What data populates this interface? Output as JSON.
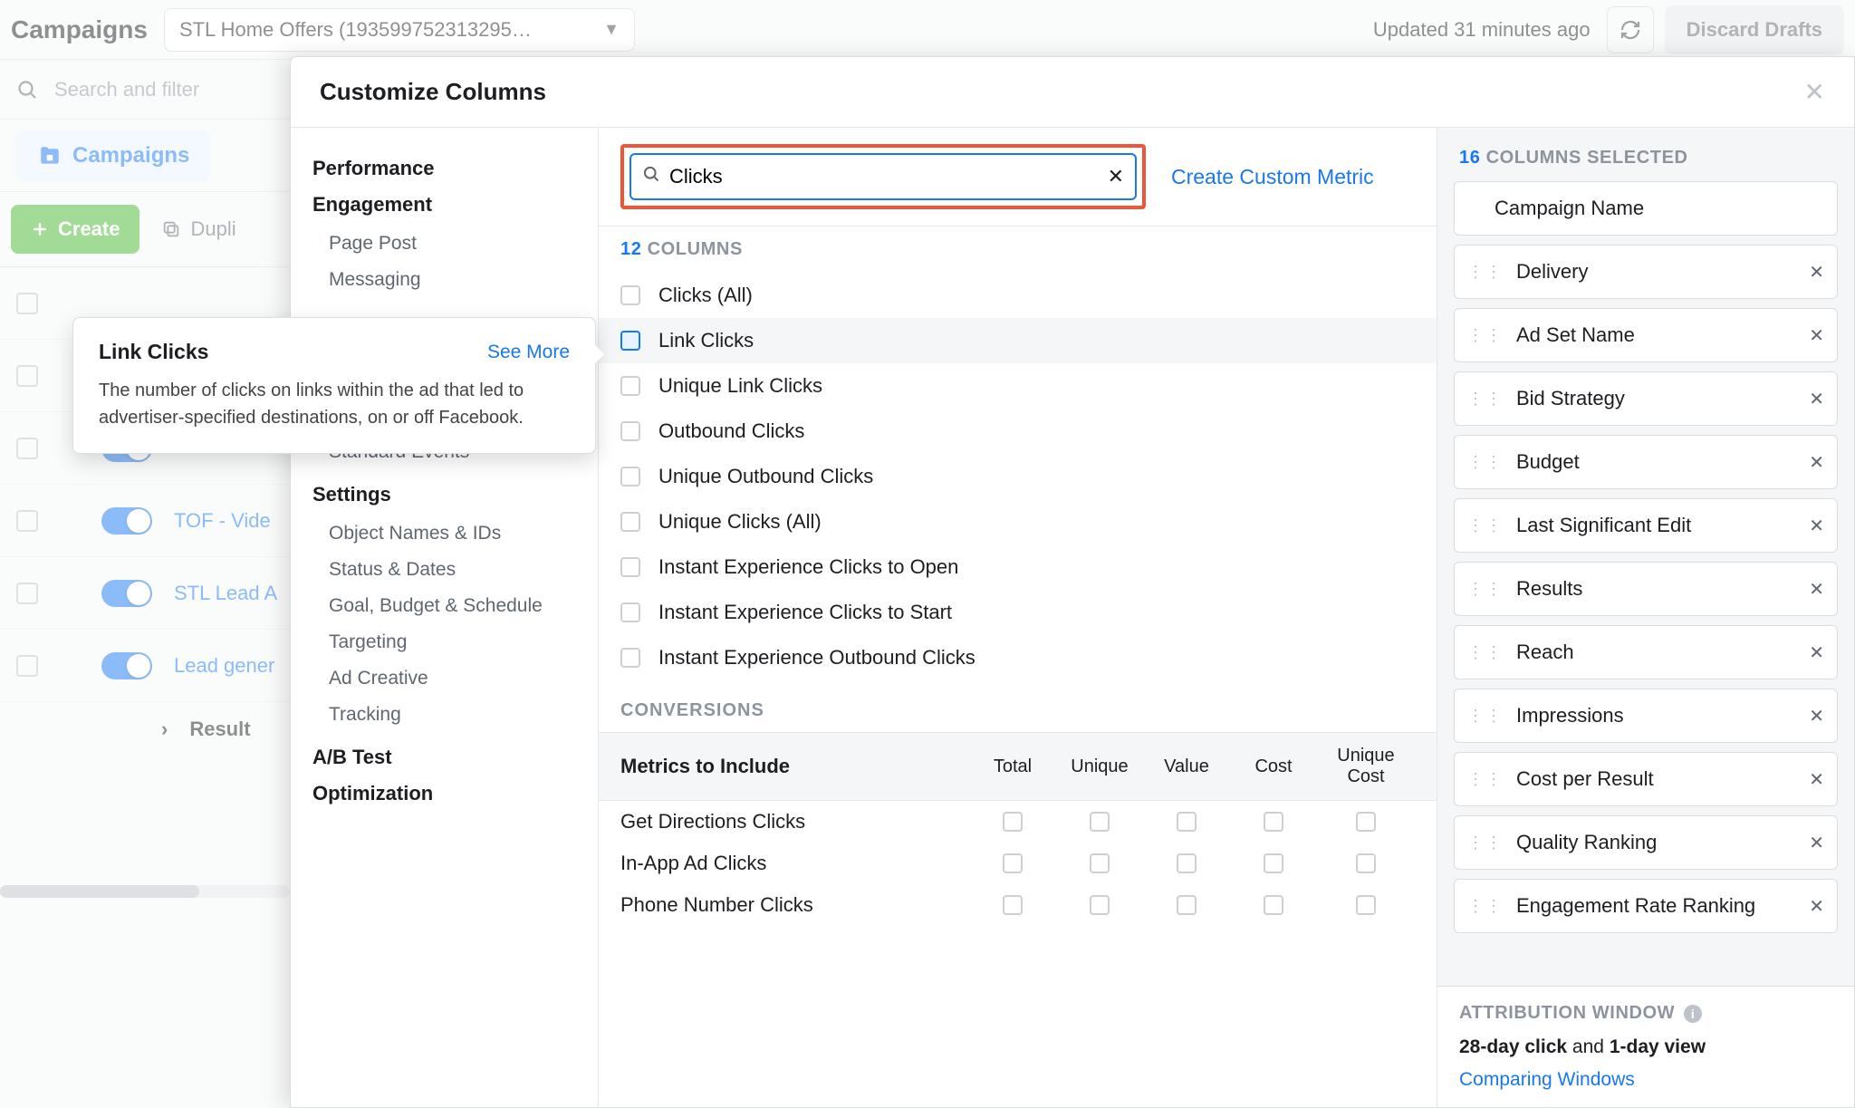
{
  "topbar": {
    "title": "Campaigns",
    "account": "STL Home Offers (193599752313295…",
    "updated": "Updated 31 minutes ago",
    "discard": "Discard Drafts"
  },
  "searchrow": {
    "placeholder": "Search and filter"
  },
  "tabrow": {
    "campaigns": "Campaigns"
  },
  "createrow": {
    "create": "Create",
    "duplicate": "Dupli"
  },
  "rows": {
    "r3": "TOF - Vide",
    "r4": "STL Lead A",
    "r5": "Lead gener",
    "results": "Result"
  },
  "modal": {
    "title": "Customize Columns"
  },
  "sidebar": {
    "heads": {
      "performance": "Performance",
      "engagement": "Engagement",
      "settings": "Settings",
      "abtest": "A/B Test",
      "optimization": "Optimization"
    },
    "items": {
      "pagepost": "Page Post",
      "messaging": "Messaging",
      "stdevents": "Standard Events",
      "names": "Object Names & IDs",
      "status": "Status & Dates",
      "goal": "Goal, Budget & Schedule",
      "targeting": "Targeting",
      "creative": "Ad Creative",
      "tracking": "Tracking"
    }
  },
  "center": {
    "search": "Clicks",
    "custom": "Create Custom Metric",
    "count_num": "12",
    "count_label": " COLUMNS",
    "checks": [
      "Clicks (All)",
      "Link Clicks",
      "Unique Link Clicks",
      "Outbound Clicks",
      "Unique Outbound Clicks",
      "Unique Clicks (All)",
      "Instant Experience Clicks to Open",
      "Instant Experience Clicks to Start",
      "Instant Experience Outbound Clicks"
    ],
    "conv_head": "CONVERSIONS",
    "metrics_label": "Metrics to Include",
    "metric_cols": [
      "Total",
      "Unique",
      "Value",
      "Cost",
      "Unique Cost"
    ],
    "metric_rows": [
      "Get Directions Clicks",
      "In-App Ad Clicks",
      "Phone Number Clicks"
    ]
  },
  "right": {
    "count_num": "16",
    "count_label": " COLUMNS SELECTED",
    "items": [
      "Campaign Name",
      "Delivery",
      "Ad Set Name",
      "Bid Strategy",
      "Budget",
      "Last Significant Edit",
      "Results",
      "Reach",
      "Impressions",
      "Cost per Result",
      "Quality Ranking",
      "Engagement Rate Ranking"
    ]
  },
  "attr": {
    "head": "ATTRIBUTION WINDOW",
    "line_pre": "28-day click",
    "line_mid": " and ",
    "line_post": "1-day view",
    "link": "Comparing Windows"
  },
  "popover": {
    "title": "Link Clicks",
    "more": "See More",
    "body": "The number of clicks on links within the ad that led to advertiser-specified destinations, on or off Facebook."
  }
}
